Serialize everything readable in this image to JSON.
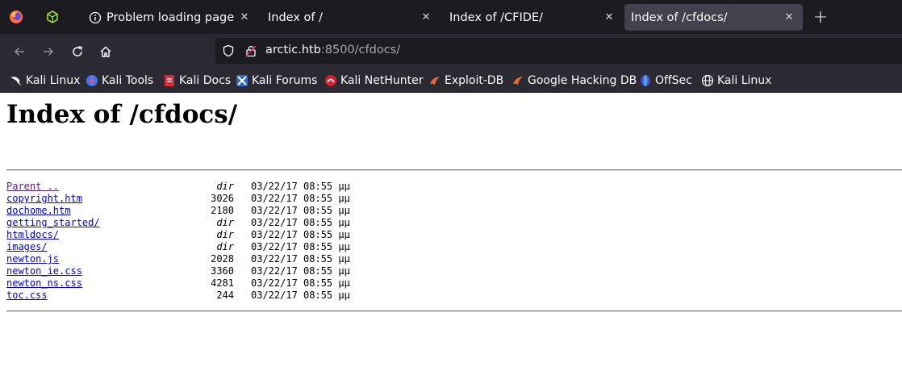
{
  "tabs": [
    {
      "title": "Problem loading page",
      "active": false
    },
    {
      "title": "Index of /",
      "active": false
    },
    {
      "title": "Index of /CFIDE/",
      "active": false
    },
    {
      "title": "Index of /cfdocs/",
      "active": true
    }
  ],
  "url": {
    "host": "arctic.htb",
    "rest": ":8500/cfdocs/"
  },
  "bookmarks": [
    "Kali Linux",
    "Kali Tools",
    "Kali Docs",
    "Kali Forums",
    "Kali NetHunter",
    "Exploit-DB",
    "Google Hacking DB",
    "OffSec",
    "Kali Linux"
  ],
  "page": {
    "heading": "Index of /cfdocs/",
    "entries": [
      {
        "name": "Parent ..",
        "size": "dir",
        "date": "03/22/17 08:55 μμ"
      },
      {
        "name": "copyright.htm",
        "size": "3026",
        "date": "03/22/17 08:55 μμ"
      },
      {
        "name": "dochome.htm",
        "size": "2180",
        "date": "03/22/17 08:55 μμ"
      },
      {
        "name": "getting_started/",
        "size": "dir",
        "date": "03/22/17 08:55 μμ"
      },
      {
        "name": "htmldocs/",
        "size": "dir",
        "date": "03/22/17 08:55 μμ"
      },
      {
        "name": "images/",
        "size": "dir",
        "date": "03/22/17 08:55 μμ"
      },
      {
        "name": "newton.js",
        "size": "2028",
        "date": "03/22/17 08:55 μμ"
      },
      {
        "name": "newton_ie.css",
        "size": "3360",
        "date": "03/22/17 08:55 μμ"
      },
      {
        "name": "newton_ns.css",
        "size": "4281",
        "date": "03/22/17 08:55 μμ"
      },
      {
        "name": "toc.css",
        "size": "244",
        "date": "03/22/17 08:55 μμ"
      }
    ]
  },
  "icons": {
    "firefox": "firefox-icon",
    "extensions": "cube-icon",
    "info": "info-icon",
    "back": "back-arrow-icon",
    "forward": "forward-arrow-icon",
    "reload": "reload-icon",
    "home": "home-icon",
    "shield": "shield-icon",
    "lock": "insecure-lock-icon",
    "globe": "globe-icon"
  },
  "colors": {
    "link": "#0000ee",
    "visited_link": "#551a8b",
    "chrome_dark": "#1c1b22",
    "toolbar": "#2b2a33",
    "active_tab": "#42414d"
  }
}
